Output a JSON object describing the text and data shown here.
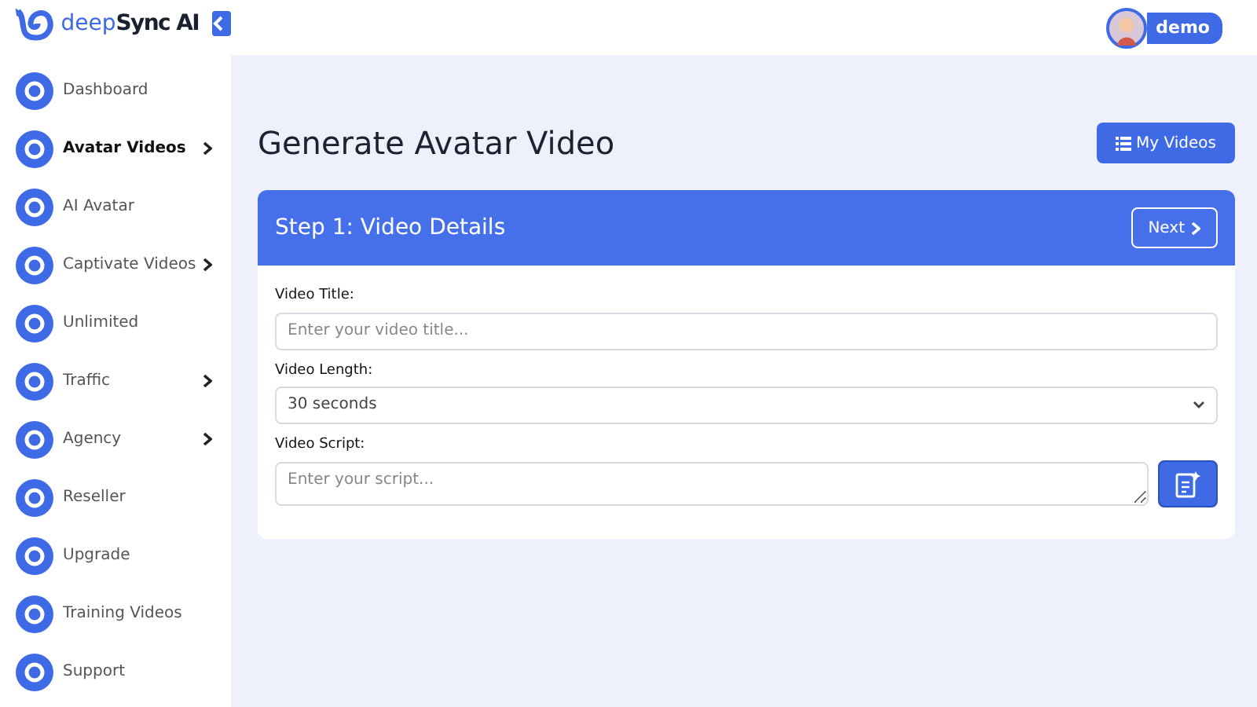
{
  "brand": {
    "part_1": "deep",
    "part_2": "Sync AI"
  },
  "user": {
    "name": "demo"
  },
  "sidebar": {
    "items": [
      {
        "label": "Dashboard",
        "selected": false,
        "kind": "link"
      },
      {
        "label": "Avatar Videos",
        "selected": true,
        "kind": "submenu"
      },
      {
        "label": "AI Avatar",
        "selected": false,
        "kind": "link"
      },
      {
        "label": "Captivate Videos",
        "selected": false,
        "kind": "submenu"
      },
      {
        "label": "Unlimited",
        "selected": false,
        "kind": "link"
      },
      {
        "label": "Traffic",
        "selected": false,
        "kind": "submenu"
      },
      {
        "label": "Agency",
        "selected": false,
        "kind": "submenu"
      },
      {
        "label": "Reseller",
        "selected": false,
        "kind": "link"
      },
      {
        "label": "Upgrade",
        "selected": false,
        "kind": "link"
      },
      {
        "label": "Training Videos",
        "selected": false,
        "kind": "link"
      },
      {
        "label": "Support",
        "selected": false,
        "kind": "link"
      }
    ]
  },
  "page": {
    "title": "Generate Avatar Video",
    "my_videos_button": "My Videos"
  },
  "card": {
    "title": "Step 1: Video Details",
    "next_button": "Next",
    "fields": [
      {
        "kind": "input",
        "label": "Video Title:",
        "placeholder": "Enter your video title..."
      },
      {
        "kind": "select",
        "label": "Video Length:",
        "value": "30 seconds"
      },
      {
        "kind": "textarea",
        "label": "Video Script:",
        "placeholder": "Enter your script..."
      }
    ]
  }
}
